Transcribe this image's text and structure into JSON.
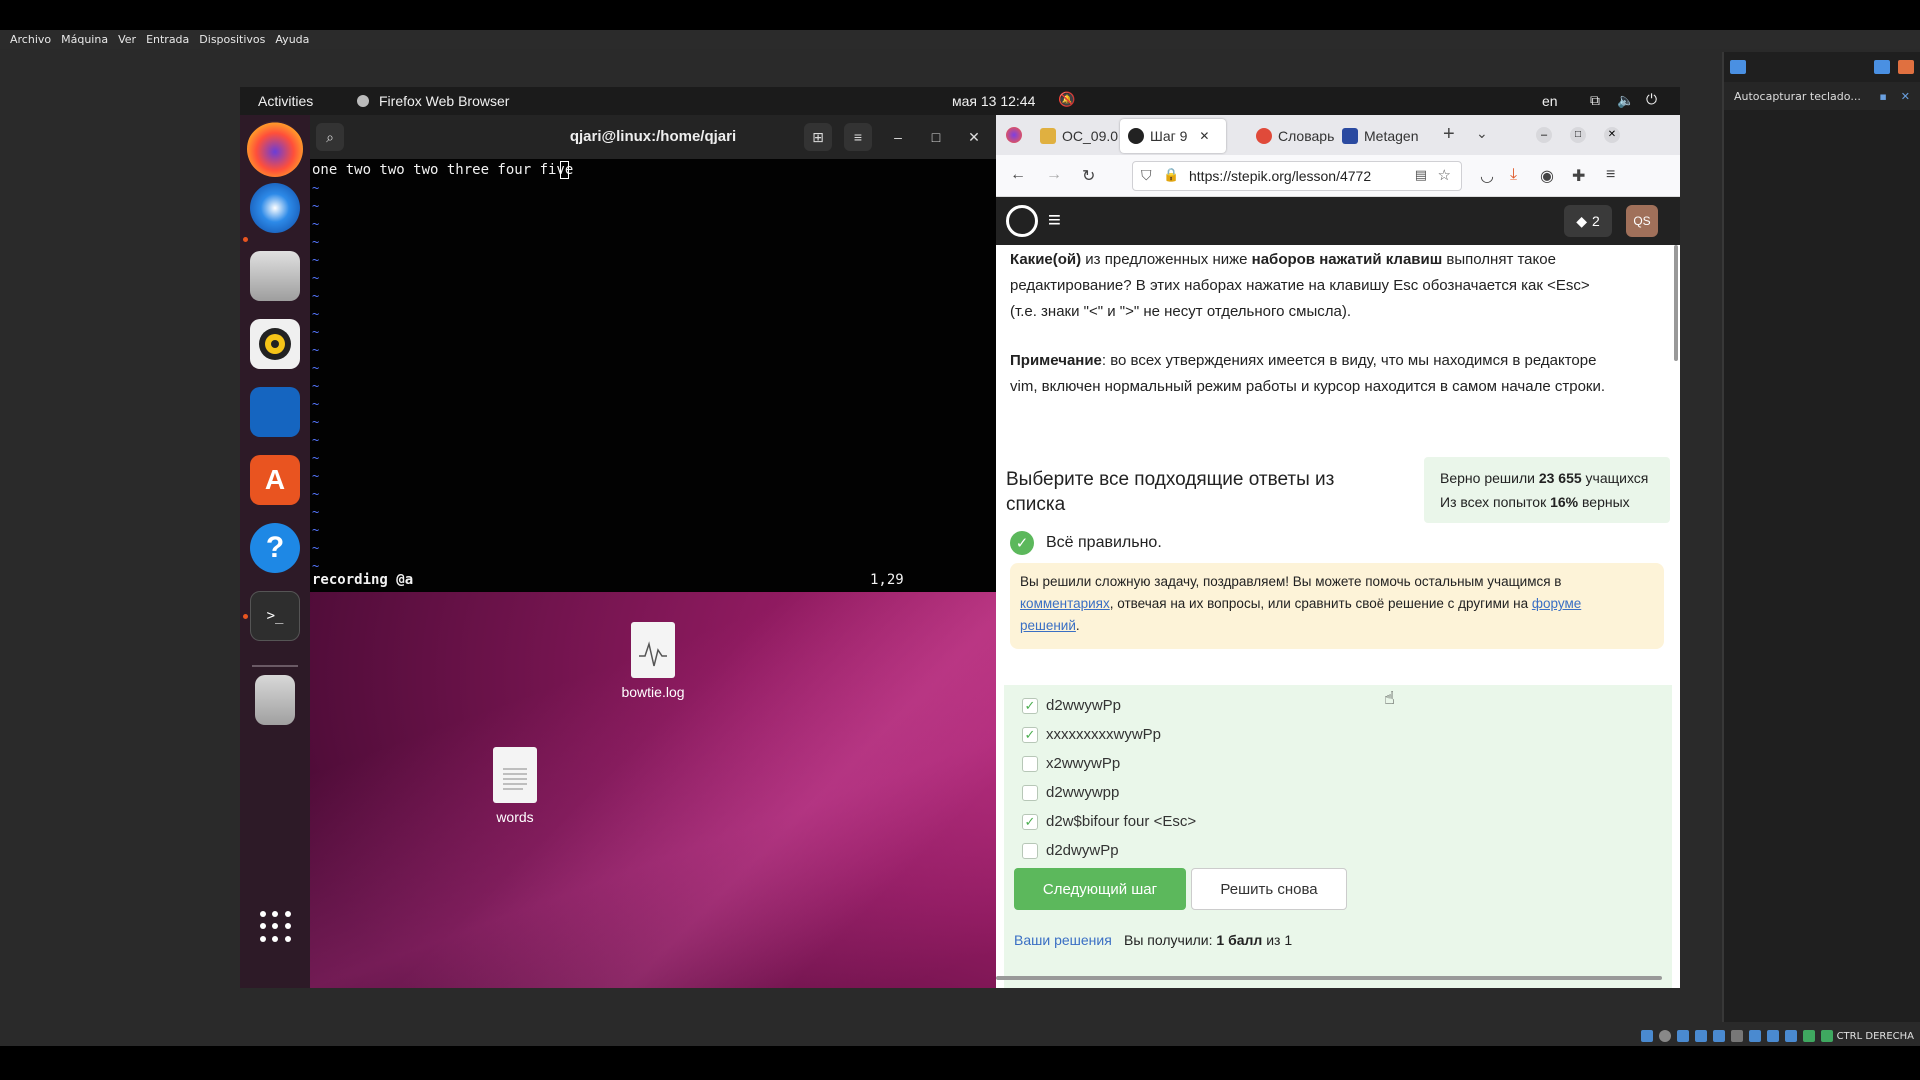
{
  "host": {
    "menu": [
      "Archivo",
      "Máquina",
      "Ver",
      "Entrada",
      "Dispositivos",
      "Ayuda"
    ],
    "side_panel": {
      "item_label": "Autocapturar teclado..."
    },
    "status_text": "CTRL DERECHA"
  },
  "topbar": {
    "activities": "Activities",
    "app_name": "Firefox Web Browser",
    "clock": "мая 13  12:44",
    "lang": "en"
  },
  "terminal": {
    "title": "qjari@linux:/home/qjari",
    "line1": "one two two two three four five",
    "status_left": "recording @a",
    "status_right": "1,29",
    "tilde_char": "~"
  },
  "desktop": {
    "files": [
      {
        "name": "bowtie.log"
      },
      {
        "name": "words"
      }
    ]
  },
  "firefox": {
    "tabs": [
      {
        "label": "OC_09.0"
      },
      {
        "label": "Шаг 9"
      },
      {
        "label": "Словарь"
      },
      {
        "label": "Metagen"
      }
    ],
    "url": "https://stepik.org/lesson/4772"
  },
  "stepik": {
    "badge_count": "2",
    "avatar": "QS",
    "question_line1_a": "Какие(ой)",
    "question_line1_b": " из предложенных ниже ",
    "question_line1_c": "наборов нажатий клавиш",
    "question_line1_d": " выполнят такое",
    "question_line2": "редактирование? В этих наборах нажатие на клавишу Esc обозначается как <Esc>",
    "question_line3": "(т.е. знаки \"<\" и \">\" не несут отдельного смысла).",
    "note_label": "Примечание",
    "note_line1": ": во всех утверждениях имеется в виду, что мы находимся в редакторе",
    "note_line2": "vim, включен нормальный режим работы и курсор находится в самом начале строки.",
    "choose_title": "Выберите все подходящие ответы из списка",
    "stats_line1_a": "Верно решили ",
    "stats_line1_b": "23 655",
    "stats_line1_c": " учащихся",
    "stats_line2_a": "Из всех попыток ",
    "stats_line2_b": "16%",
    "stats_line2_c": " верных",
    "correct_text": "Всё правильно.",
    "congrats_a": "Вы решили сложную задачу, поздравляем! Вы можете помочь остальным учащимся в",
    "congrats_link1": "комментариях",
    "congrats_b": ", отвечая на их вопросы, или сравнить своё решение с другими на ",
    "congrats_link2a": "форуме",
    "congrats_link2b": "решений",
    "congrats_end": ".",
    "options": [
      {
        "label": "d2wwywPp",
        "checked": true
      },
      {
        "label": "xxxxxxxxxwywPp",
        "checked": true
      },
      {
        "label": "x2wwywPp",
        "checked": false
      },
      {
        "label": "d2wwywpp",
        "checked": false
      },
      {
        "label": "d2w$bifour four <Esc>",
        "checked": true
      },
      {
        "label": "d2dwywPp",
        "checked": false
      }
    ],
    "next_button": "Следующий шаг",
    "retry_button": "Решить снова",
    "your_solutions": "Ваши решения",
    "score_a": "Вы получили: ",
    "score_b": "1 балл",
    "score_c": " из 1"
  }
}
